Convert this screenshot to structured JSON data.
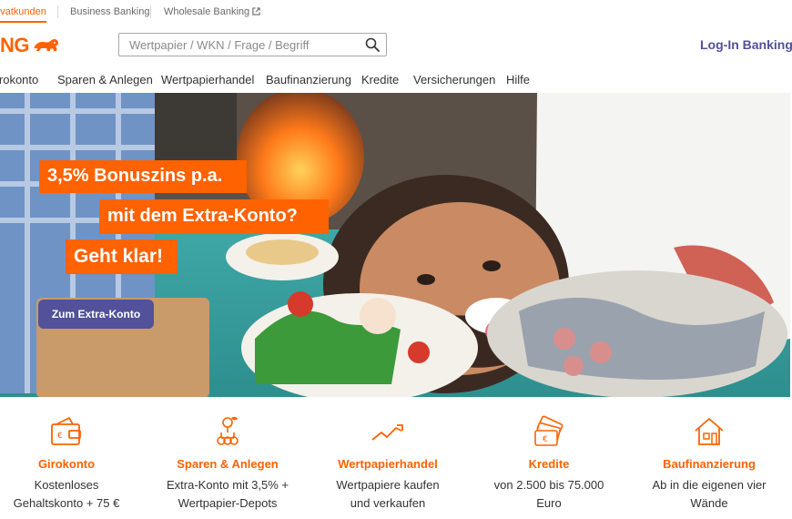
{
  "brand": {
    "logo_text": "NG",
    "accent_color": "#ff6200",
    "secondary_color": "#525199"
  },
  "segments": {
    "private": "rivatkunden",
    "business": "Business Banking",
    "wholesale": "Wholesale Banking",
    "wholesale_icon": "external-link-icon"
  },
  "search": {
    "placeholder": "Wertpapier / WKN / Frage / Begriff",
    "value": "",
    "icon": "search-icon"
  },
  "header": {
    "login_label": "Log-In Banking"
  },
  "nav": {
    "items": [
      "irokonto",
      "Sparen & Anlegen",
      "Wertpapierhandel",
      "Baufinanzierung",
      "Kredite",
      "Versicherungen",
      "Hilfe"
    ]
  },
  "hero": {
    "line1": "3,5% Bonuszins p.a.",
    "line2": "mit dem Extra-Konto?",
    "line3": "Geht klar!",
    "cta_label": "Zum Extra-Konto"
  },
  "products": [
    {
      "icon": "wallet-icon",
      "title": "Girokonto",
      "line1": "Kostenloses",
      "line2": "Gehaltskonto + 75 €"
    },
    {
      "icon": "savings-plant-icon",
      "title": "Sparen & Anlegen",
      "line1": "Extra-Konto mit 3,5% +",
      "line2": "Wertpapier-Depots"
    },
    {
      "icon": "trend-chart-icon",
      "title": "Wertpapierhandel",
      "line1": "Wertpapiere kaufen",
      "line2": "und verkaufen"
    },
    {
      "icon": "money-notes-icon",
      "title": "Kredite",
      "line1": "von 2.500 bis 75.000",
      "line2": "Euro"
    },
    {
      "icon": "house-icon",
      "title": "Baufinanzierung",
      "line1": "Ab in die eigenen vier",
      "line2": "Wände"
    }
  ]
}
